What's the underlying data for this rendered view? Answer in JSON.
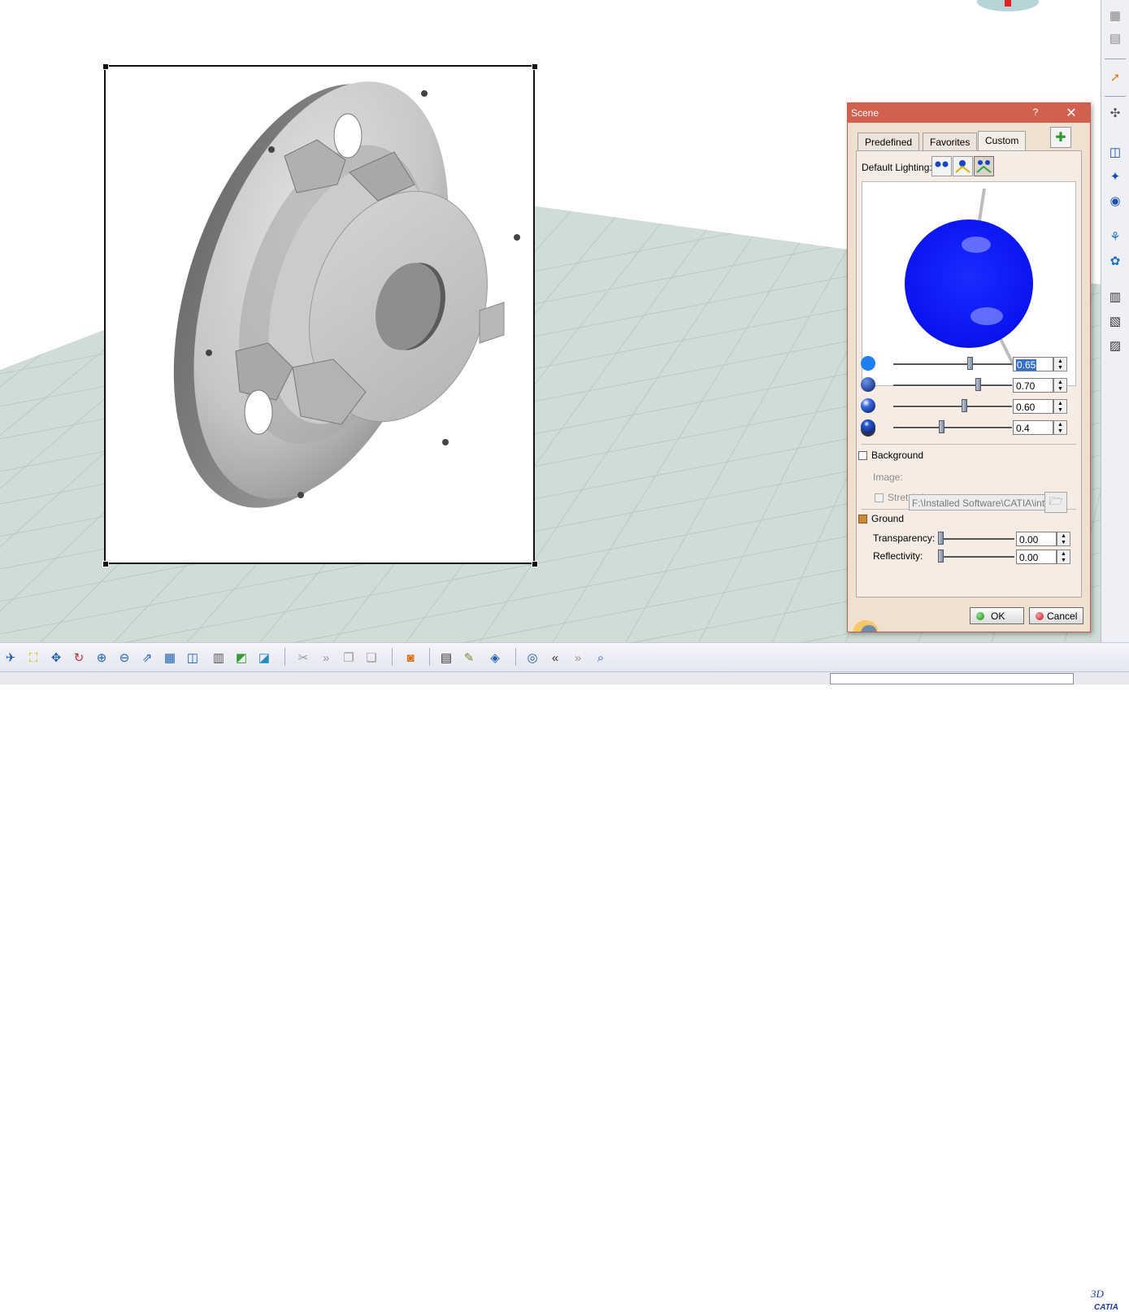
{
  "app": {
    "name": "CATIA",
    "logo_text": "CATIA"
  },
  "viewport": {
    "floor_color": "#cfddd6",
    "grid_color": "#b5c7be"
  },
  "scene_dialog": {
    "title": "Scene",
    "help_label": "?",
    "close_label": "✕",
    "tabs": [
      {
        "label": "Predefined",
        "active": false
      },
      {
        "label": "Favorites",
        "active": false
      },
      {
        "label": "Custom",
        "active": true
      }
    ],
    "add_favorite_icon": "star-plus-icon",
    "default_lighting_label": "Default Lighting:",
    "lighting_modes": [
      "two-lights-icon",
      "single-light-icon",
      "three-lights-icon"
    ],
    "light_sphere_color": "#0a14ff",
    "sliders": [
      {
        "icon": "ambient-light-icon",
        "value": "0.65",
        "level": 0.65,
        "selected": true
      },
      {
        "icon": "diffuse-light-icon",
        "value": "0.70",
        "level": 0.72
      },
      {
        "icon": "specular-light-icon",
        "value": "0.60",
        "level": 0.6
      },
      {
        "icon": "shininess-light-icon",
        "value": "0.4",
        "level": 0.4
      }
    ],
    "background": {
      "label": "Background",
      "checked": false,
      "image_label": "Image:",
      "image_path": "F:\\Installed Software\\CATIA\\int",
      "stretch_label": "Stretch Image",
      "stretch_checked": false
    },
    "ground": {
      "label": "Ground",
      "checked": true,
      "transparency_label": "Transparency:",
      "transparency_value": "0.00",
      "transparency_level": 0.0,
      "reflectivity_label": "Reflectivity:",
      "reflectivity_value": "0.00",
      "reflectivity_level": 0.0
    },
    "ok_label": "OK",
    "cancel_label": "Cancel"
  },
  "right_toolbar_icons": [
    "window-tile-icon",
    "window-cascade-icon",
    "select-arrow-icon",
    "snap-icon",
    "box-icon",
    "light-icon",
    "camera-icon",
    "scene-icon",
    "material-icon",
    "film-icon",
    "animation-icon",
    "clip-icon"
  ],
  "bottom_toolbar_icons": [
    "fly-mode-icon",
    "fit-all-icon",
    "pan-icon",
    "rotate-icon",
    "zoom-in-icon",
    "zoom-out-icon",
    "normal-view-icon",
    "multi-view-icon",
    "iso-view-icon",
    "render-style-icon",
    "hide-show-icon",
    "swap-space-icon",
    "cut-icon",
    "next-icon",
    "copy-icon",
    "paste-icon",
    "capture-icon",
    "publish-icon",
    "sketch-icon",
    "catalog-icon",
    "compass-icon",
    "rewind-icon",
    "forward-icon",
    "search-icon"
  ]
}
